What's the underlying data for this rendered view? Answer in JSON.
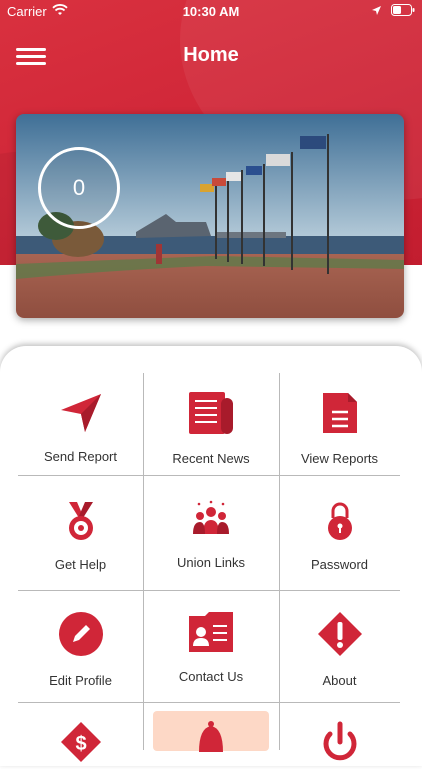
{
  "status_bar": {
    "carrier": "Carrier",
    "time": "10:30 AM"
  },
  "header": {
    "title": "Home"
  },
  "hero": {
    "counter": "0"
  },
  "colors": {
    "brand_red": "#d02638",
    "grid_line": "#b9b9b9"
  },
  "menu": [
    {
      "label": "Send Report",
      "icon": "send-icon"
    },
    {
      "label": "Recent News",
      "icon": "newspaper-icon"
    },
    {
      "label": "View Reports",
      "icon": "document-icon"
    },
    {
      "label": "Get Help",
      "icon": "medal-icon"
    },
    {
      "label": "Union Links",
      "icon": "group-icon"
    },
    {
      "label": "Password",
      "icon": "lock-icon"
    },
    {
      "label": "Edit Profile",
      "icon": "pencil-icon"
    },
    {
      "label": "Contact Us",
      "icon": "contact-card-icon"
    },
    {
      "label": "About",
      "icon": "alert-icon"
    },
    {
      "label": "",
      "icon": "dollar-tag-icon"
    },
    {
      "label": "",
      "icon": "bell-icon"
    },
    {
      "label": "",
      "icon": "power-icon"
    }
  ]
}
